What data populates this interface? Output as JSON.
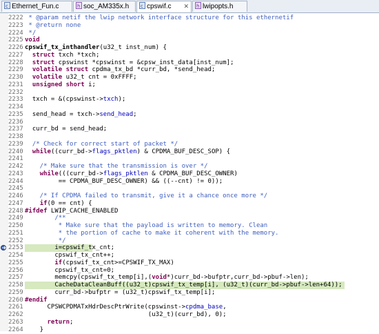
{
  "tabs": [
    {
      "label": "Ethernet_Fun.c",
      "active": false
    },
    {
      "label": "soc_AM335x.h",
      "active": false
    },
    {
      "label": "cpswif.c",
      "active": true
    },
    {
      "label": "lwipopts.h",
      "active": false
    }
  ],
  "colors": {
    "keyword": "#7f0055",
    "comment": "#3f5fbf",
    "field": "#0000c0",
    "highlight": "#d6e9bf"
  },
  "current_line": "2253",
  "highlighted_lines": [
    "2253",
    "2258"
  ],
  "lines": [
    {
      "n": "2222",
      "segs": [
        [
          " * @param netif the lwip network interface structure for this ethernetif",
          "cm"
        ]
      ]
    },
    {
      "n": "2223",
      "segs": [
        [
          " * @return none",
          "cm"
        ]
      ]
    },
    {
      "n": "2224",
      "segs": [
        [
          " */",
          "cm"
        ]
      ]
    },
    {
      "n": "2225",
      "segs": [
        [
          "void",
          "kw"
        ]
      ]
    },
    {
      "n": "2226",
      "segs": [
        [
          "cpswif_tx_inthandler",
          "b"
        ],
        [
          "(u32_t inst_num) {",
          ""
        ]
      ]
    },
    {
      "n": "2227",
      "segs": [
        [
          "  ",
          ""
        ],
        [
          "struct",
          "kw"
        ],
        [
          " txch *txch;",
          ""
        ]
      ]
    },
    {
      "n": "2228",
      "segs": [
        [
          "  ",
          ""
        ],
        [
          "struct",
          "kw"
        ],
        [
          " cpswinst *cpswinst = &cpsw_inst_data[inst_num];",
          ""
        ]
      ]
    },
    {
      "n": "2229",
      "segs": [
        [
          "  ",
          ""
        ],
        [
          "volatile struct",
          "kw"
        ],
        [
          " cpdma_tx_bd *curr_bd, *send_head;",
          ""
        ]
      ]
    },
    {
      "n": "2230",
      "segs": [
        [
          "  ",
          ""
        ],
        [
          "volatile",
          "kw"
        ],
        [
          " u32_t cnt = 0xFFFF;",
          ""
        ]
      ]
    },
    {
      "n": "2231",
      "segs": [
        [
          "  ",
          ""
        ],
        [
          "unsigned short",
          "kw"
        ],
        [
          " i;",
          ""
        ]
      ]
    },
    {
      "n": "2232",
      "segs": []
    },
    {
      "n": "2233",
      "segs": [
        [
          "  txch = &(cpswinst->",
          ""
        ],
        [
          "txch",
          "fld"
        ],
        [
          ");",
          ""
        ]
      ]
    },
    {
      "n": "2234",
      "segs": []
    },
    {
      "n": "2235",
      "segs": [
        [
          "  send_head = txch->",
          ""
        ],
        [
          "send_head",
          "fld"
        ],
        [
          ";",
          ""
        ]
      ]
    },
    {
      "n": "2236",
      "segs": []
    },
    {
      "n": "2237",
      "segs": [
        [
          "  curr_bd = send_head;",
          ""
        ]
      ]
    },
    {
      "n": "2238",
      "segs": []
    },
    {
      "n": "2239",
      "segs": [
        [
          "  /* Check for correct start of packet */",
          "cm"
        ]
      ]
    },
    {
      "n": "2240",
      "segs": [
        [
          "  ",
          ""
        ],
        [
          "while",
          "kw"
        ],
        [
          "((curr_bd->",
          ""
        ],
        [
          "flags_pktlen",
          "fld"
        ],
        [
          ") & CPDMA_BUF_DESC_SOP) {",
          ""
        ]
      ]
    },
    {
      "n": "2241",
      "segs": []
    },
    {
      "n": "2242",
      "segs": [
        [
          "    /* Make sure that the transmission is over */",
          "cm"
        ]
      ]
    },
    {
      "n": "2243",
      "segs": [
        [
          "    ",
          ""
        ],
        [
          "while",
          "kw"
        ],
        [
          "(((curr_bd->",
          ""
        ],
        [
          "flags_pktlen",
          "fld"
        ],
        [
          " & CPDMA_BUF_DESC_OWNER)",
          ""
        ]
      ]
    },
    {
      "n": "2244",
      "segs": [
        [
          "         == CPDMA_BUF_DESC_OWNER) && ((--cnt) != 0));",
          ""
        ]
      ]
    },
    {
      "n": "2245",
      "segs": []
    },
    {
      "n": "2246",
      "segs": [
        [
          "    /* If CPDMA failed to transmit, give it a chance once more */",
          "cm"
        ]
      ]
    },
    {
      "n": "2247",
      "segs": [
        [
          "    ",
          ""
        ],
        [
          "if",
          "kw"
        ],
        [
          "(0 == cnt) {",
          ""
        ]
      ]
    },
    {
      "n": "2248",
      "segs": [
        [
          "#ifdef",
          "kw"
        ],
        [
          " LWIP_CACHE_ENABLED",
          ""
        ]
      ]
    },
    {
      "n": "2249",
      "segs": [
        [
          "        /**",
          "cm"
        ]
      ]
    },
    {
      "n": "2250",
      "segs": [
        [
          "         * Make sure that the payload is written to memory. Clean",
          "cm"
        ]
      ]
    },
    {
      "n": "2251",
      "segs": [
        [
          "         * the portion of cache to make it coherent with the memory.",
          "cm"
        ]
      ]
    },
    {
      "n": "2252",
      "segs": [
        [
          "         */",
          "cm"
        ]
      ]
    },
    {
      "n": "2253",
      "segs": [
        [
          "        i=cpswif_tx_cnt;",
          ""
        ]
      ]
    },
    {
      "n": "2254",
      "segs": [
        [
          "        cpswif_tx_cnt++;",
          ""
        ]
      ]
    },
    {
      "n": "2255",
      "segs": [
        [
          "        ",
          ""
        ],
        [
          "if",
          "kw"
        ],
        [
          "(cpswif_tx_cnt>=CPSWIF_TX_MAX)",
          ""
        ]
      ]
    },
    {
      "n": "2256",
      "segs": [
        [
          "        cpswif_tx_cnt=0;",
          ""
        ]
      ]
    },
    {
      "n": "2257",
      "segs": [
        [
          "        memcpy(cpswif_tx_temp[i],(",
          ""
        ],
        [
          "void",
          "kw"
        ],
        [
          "*)curr_bd->bufptr,curr_bd->pbuf->len);",
          ""
        ]
      ]
    },
    {
      "n": "2258",
      "segs": [
        [
          "        CacheDataCleanBuff((u32_t)cpswif_tx_temp[i], (u32_t)(curr_bd->pbuf->len+64));",
          ""
        ]
      ]
    },
    {
      "n": "2259",
      "segs": [
        [
          "        curr_bd->bufptr = (u32_t)cpswif_tx_temp[i];",
          ""
        ]
      ]
    },
    {
      "n": "2260",
      "segs": [
        [
          "#endif",
          "kw"
        ]
      ]
    },
    {
      "n": "2261",
      "segs": [
        [
          "      CPSWCPDMATxHdrDescPtrWrite(cpswinst->",
          ""
        ],
        [
          "cpdma_base",
          "fld"
        ],
        [
          ",",
          ""
        ]
      ]
    },
    {
      "n": "2262",
      "segs": [
        [
          "                                 (u32_t)(curr_bd), 0);",
          ""
        ]
      ]
    },
    {
      "n": "2263",
      "segs": [
        [
          "      ",
          ""
        ],
        [
          "return",
          "kw"
        ],
        [
          ";",
          ""
        ]
      ]
    },
    {
      "n": "2264",
      "segs": [
        [
          "    }",
          ""
        ]
      ]
    }
  ]
}
